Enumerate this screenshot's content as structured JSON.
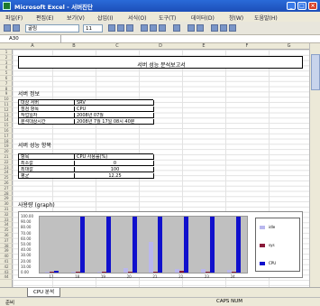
{
  "window": {
    "title": "Microsoft Excel - 서버진단",
    "min": "_",
    "max": "□",
    "close": "×"
  },
  "menu": [
    "파일(F)",
    "편집(E)",
    "보기(V)",
    "삽입(I)",
    "서식(O)",
    "도구(T)",
    "데이터(D)",
    "창(W)",
    "도움말(H)"
  ],
  "toolbar": {
    "font": "굴림",
    "size": "11"
  },
  "formula": {
    "namebox": "A30"
  },
  "columns": [
    "A",
    "B",
    "C",
    "D",
    "E",
    "F",
    "G"
  ],
  "rows": [
    "1",
    "2",
    "3",
    "4",
    "5",
    "6",
    "7",
    "8",
    "9",
    "10",
    "11",
    "12",
    "13",
    "14",
    "15",
    "16",
    "17",
    "18",
    "19",
    "20",
    "21",
    "22",
    "23",
    "24",
    "25",
    "26",
    "27",
    "28",
    "29",
    "30",
    "31",
    "32",
    "33",
    "34",
    "35",
    "36",
    "37",
    "38",
    "39",
    "40",
    "41",
    "42",
    "43",
    "44"
  ],
  "report": {
    "title": "서버 성능 분석보고서",
    "server_section": "서버 정보",
    "server_rows": [
      [
        "대상 서버",
        "SRV"
      ],
      [
        "점검 항목",
        "CPU"
      ],
      [
        "작업일자",
        "2008년 07월"
      ],
      [
        "분석대상시간",
        "2008년 7월 17일 08시 40분"
      ]
    ],
    "perf_section": "서버 성능 항목",
    "perf_rows": [
      [
        "항목",
        "CPU 사용률(%)"
      ],
      [
        "최소값",
        "0"
      ],
      [
        "최대값",
        "100"
      ],
      [
        "평균",
        "12.25"
      ]
    ],
    "chart_section": "사용량 (graph)"
  },
  "chart_data": {
    "type": "bar",
    "categories": [
      "17",
      "18",
      "19",
      "20",
      "21",
      "22",
      "23",
      "24"
    ],
    "series": [
      {
        "name": "CPU",
        "color": "#1010cc",
        "values": [
          3,
          100,
          100,
          100,
          100,
          100,
          100,
          100
        ]
      },
      {
        "name": "idle",
        "color": "#b9b7ee",
        "values": [
          2,
          1,
          2,
          8,
          55,
          7,
          6,
          5
        ]
      },
      {
        "name": "sys",
        "color": "#8a1a3a",
        "values": [
          1,
          1,
          1,
          1,
          2,
          3,
          1,
          1
        ]
      }
    ],
    "yticks": [
      "100.00",
      "90.00",
      "80.00",
      "70.00",
      "60.00",
      "50.00",
      "40.00",
      "30.00",
      "20.00",
      "10.00",
      "0.00"
    ],
    "ylim": [
      0,
      100
    ]
  },
  "sheet": {
    "tab": "CPU 분석"
  },
  "status": {
    "left": "준비",
    "right": "CAPS NUM"
  }
}
